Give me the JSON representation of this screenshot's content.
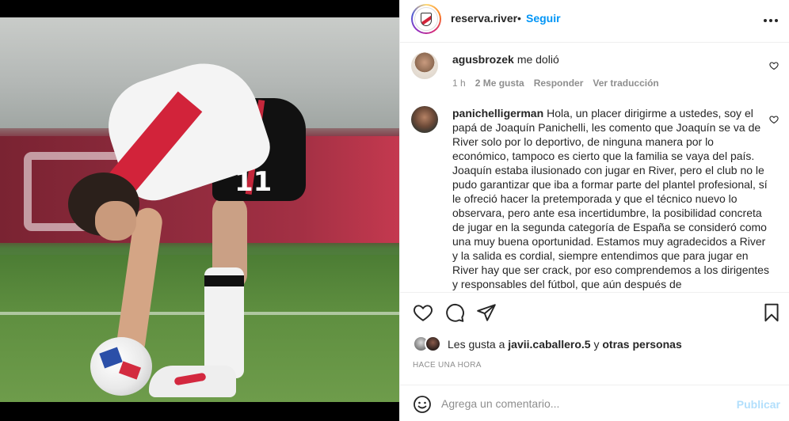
{
  "post": {
    "username": "reserva.river",
    "separator": "•",
    "follow_label": "Seguir",
    "more_icon": "more-horizontal-icon"
  },
  "media": {
    "jersey_number": "11"
  },
  "comments": [
    {
      "username": "agusbrozek",
      "text": "me dolió",
      "time": "1 h",
      "likes": "2 Me gusta",
      "reply_label": "Responder",
      "translate_label": "Ver traducción"
    },
    {
      "username": "panichelligerman",
      "text": "Hola, un placer dirigirme a ustedes, soy el papá de Joaquín Panichelli, les comento que Joaquín se va de River solo por lo deportivo, de ninguna manera por lo económico, tampoco es cierto que la familia se vaya del país. Joaquín estaba ilusionado con jugar en River, pero el club no le pudo garantizar que iba a formar parte del plantel profesional, sí le ofreció hacer la pretemporada y que el técnico nuevo lo observara, pero ante esa incertidumbre, la posibilidad concreta de jugar en la segunda categoría de España se consideró como una muy buena oportunidad. Estamos muy agradecidos a River y la salida es cordial, siempre entendimos que para jugar en River hay que ser crack, por eso comprendemos a los dirigentes y responsables del fútbol, que aún después de"
    }
  ],
  "likes": {
    "prefix": "Les gusta a",
    "user": "javii.caballero.5",
    "joiner": "y",
    "others": "otras personas"
  },
  "timestamp": "HACE UNA HORA",
  "comment_box": {
    "placeholder": "Agrega un comentario...",
    "publish_label": "Publicar"
  }
}
